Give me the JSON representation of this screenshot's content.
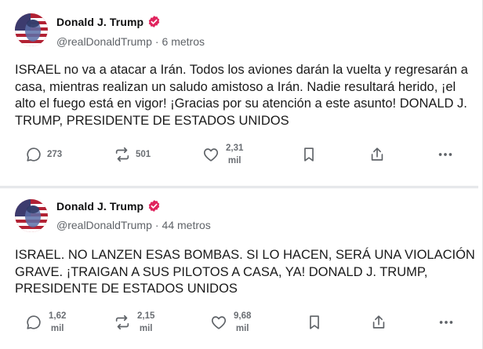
{
  "posts": [
    {
      "display_name": "Donald J. Trump",
      "handle": "@realDonaldTrump",
      "separator": "·",
      "time": "6 metros",
      "text": "ISRAEL no va a atacar a Irán. Todos los aviones darán la vuelta y regresarán a casa, mientras realizan un saludo amistoso a Irán. Nadie resultará herido, ¡el alto el fuego está en vigor! ¡Gracias por su atención a este asunto! DONALD J. TRUMP, PRESIDENTE DE ESTADOS UNIDOS",
      "replies": "273",
      "reposts": "501",
      "likes_num": "2,31",
      "likes_unit": "mil"
    },
    {
      "display_name": "Donald J. Trump",
      "handle": "@realDonaldTrump",
      "separator": "·",
      "time": "44 metros",
      "text": "ISRAEL. NO LANZEN ESAS BOMBAS. SI LO HACEN, SERÁ UNA VIOLACIÓN GRAVE. ¡TRAIGAN A SUS PILOTOS A CASA, YA! DONALD J. TRUMP, PRESIDENTE DE ESTADOS UNIDOS",
      "replies_num": "1,62",
      "replies_unit": "mil",
      "reposts_num": "2,15",
      "reposts_unit": "mil",
      "likes_num": "9,68",
      "likes_unit": "mil"
    }
  ],
  "icons": {
    "reply": "speech-bubble-icon",
    "repost": "repost-arrows-icon",
    "like": "heart-icon",
    "bookmark": "bookmark-icon",
    "share": "share-upload-icon",
    "more": "more-dots-icon",
    "verified": "verified-badge-icon"
  },
  "colors": {
    "verified_badge": "#e0245e",
    "icon_gray": "#6a6e73",
    "text": "#1a1a1a",
    "muted": "#5f6368"
  }
}
